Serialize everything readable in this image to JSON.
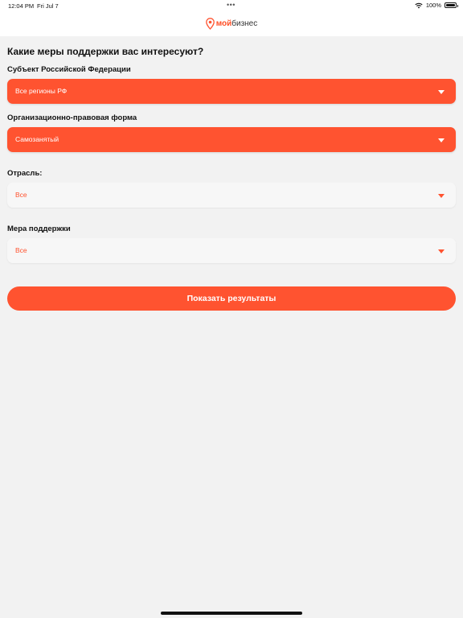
{
  "status_bar": {
    "time": "12:04 PM",
    "date": "Fri Jul 7",
    "dots": "•••",
    "battery": "100%"
  },
  "brand": {
    "part1": "мой",
    "part2": "бизнес",
    "accent_color": "#ff5330"
  },
  "form": {
    "title": "Какие меры поддержки вас интересуют?",
    "fields": [
      {
        "label": "Субъект Российской Федерации",
        "value": "Все регионы РФ",
        "style": "filled"
      },
      {
        "label": "Организационно-правовая форма",
        "value": "Самозанятый",
        "style": "filled"
      },
      {
        "label": "Отрасль:",
        "value": "Все",
        "style": "empty"
      },
      {
        "label": "Мера поддержки",
        "value": "Все",
        "style": "empty"
      }
    ],
    "submit_label": "Показать результаты"
  }
}
